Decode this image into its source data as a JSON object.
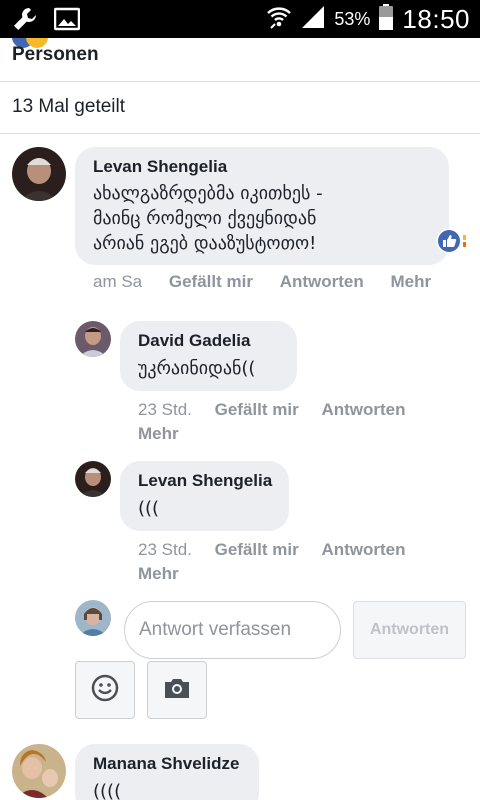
{
  "status_bar": {
    "battery_percent": "53%",
    "time": "18:50",
    "icons": [
      "wrench-icon",
      "image-icon",
      "wifi-icon",
      "signal-icon",
      "battery-icon"
    ]
  },
  "post": {
    "reactions_label": "Personen",
    "shares_label": "13 Mal geteilt"
  },
  "comments": [
    {
      "author": "Levan Shengelia",
      "text_lines": [
        "ახალგაზრდებმა იკითხეს -",
        "მაინც რომელი ქვეყნიდან",
        "არიან ეგებ დააზუსტოთო!"
      ],
      "time": "am Sa",
      "like": "Gefällt mir",
      "reply": "Antworten",
      "more": "Mehr"
    },
    {
      "author": "David Gadelia",
      "text": "უკრაინიდან((",
      "time": "23 Std.",
      "like": "Gefällt mir",
      "reply": "Antworten",
      "more": "Mehr"
    },
    {
      "author": "Levan Shengelia",
      "text": "(((",
      "time": "23 Std.",
      "like": "Gefällt mir",
      "reply": "Antworten",
      "more": "Mehr"
    },
    {
      "author": "Manana Shvelidze",
      "text": "(((("
    }
  ],
  "reply_box": {
    "placeholder": "Antwort verfassen",
    "button": "Antworten"
  },
  "colors": {
    "status_bar": "#000000",
    "bubble": "#eceef1",
    "meta_text": "#90949c",
    "like_blue": "#4267b2"
  }
}
